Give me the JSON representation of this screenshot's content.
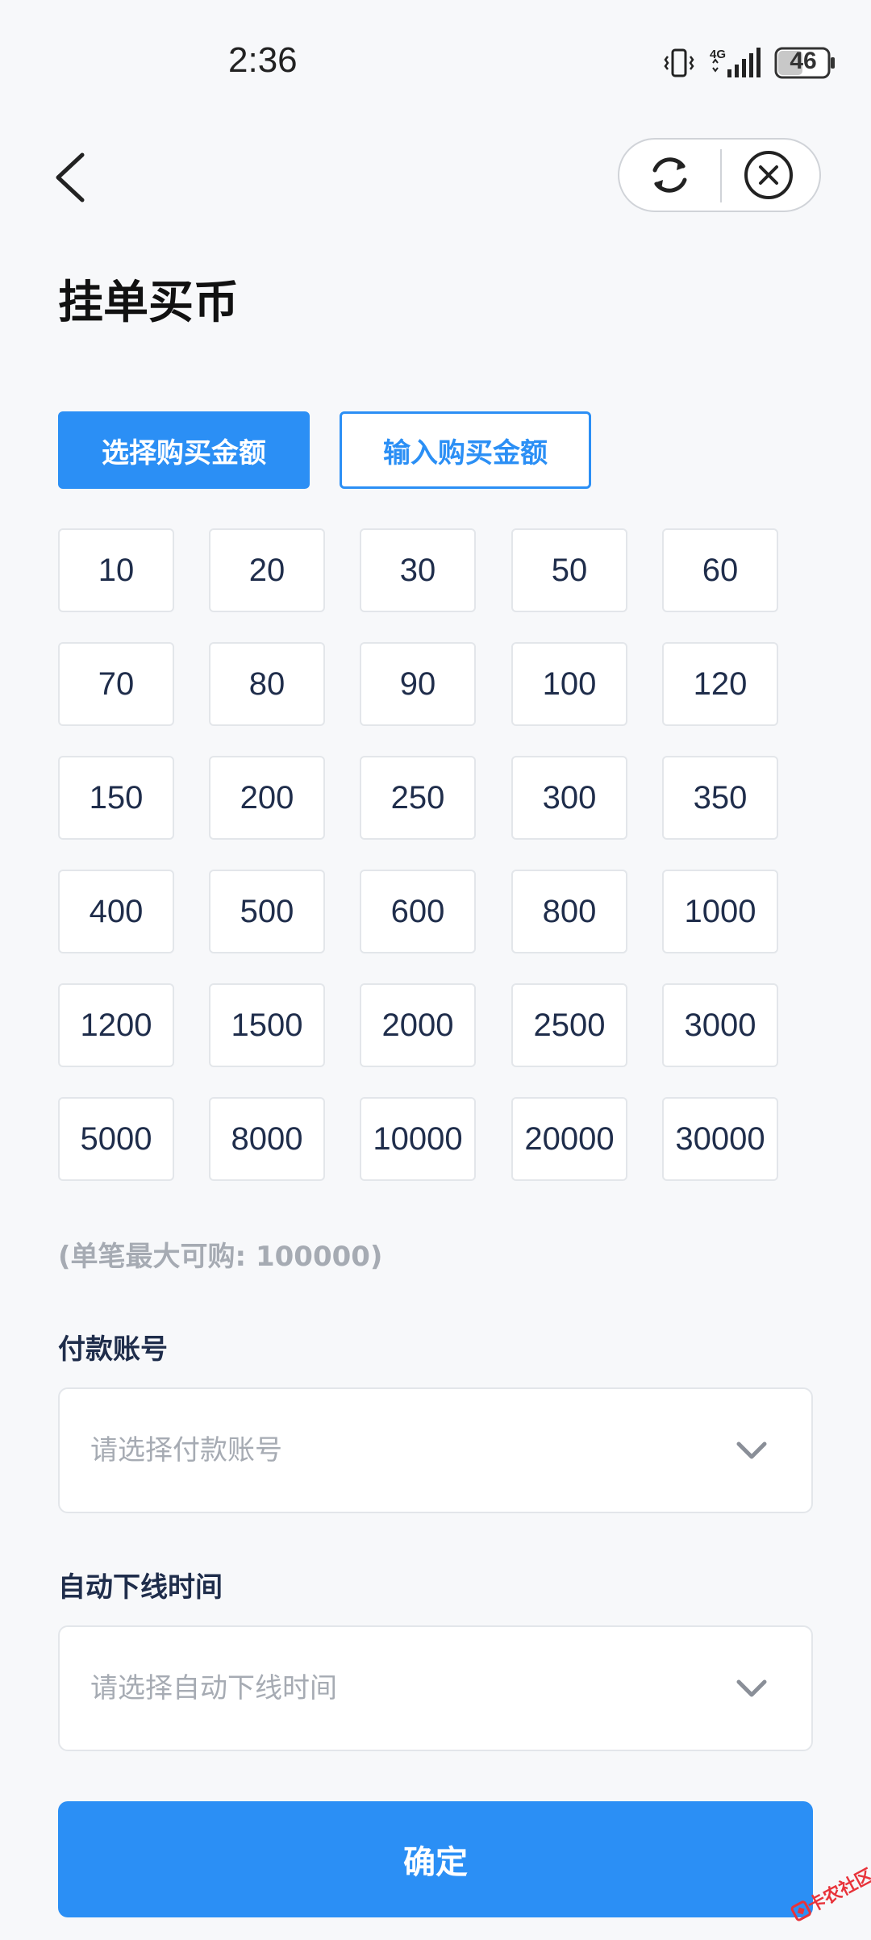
{
  "status_bar": {
    "time": "2:36",
    "network": "4G",
    "battery": "46"
  },
  "nav": {
    "back_icon": "chevron-left-icon",
    "refresh_icon": "refresh-icon",
    "close_icon": "close-circle-icon"
  },
  "page": {
    "title": "挂单买币"
  },
  "mode_tabs": {
    "select_label": "选择购买金额",
    "input_label": "输入购买金额",
    "active": "select"
  },
  "amounts": [
    "10",
    "20",
    "30",
    "50",
    "60",
    "70",
    "80",
    "90",
    "100",
    "120",
    "150",
    "200",
    "250",
    "300",
    "350",
    "400",
    "500",
    "600",
    "800",
    "1000",
    "1200",
    "1500",
    "2000",
    "2500",
    "3000",
    "5000",
    "8000",
    "10000",
    "20000",
    "30000"
  ],
  "max_note": "(单笔最大可购: 100000)",
  "payment_account": {
    "label": "付款账号",
    "placeholder": "请选择付款账号"
  },
  "offline_time": {
    "label": "自动下线时间",
    "placeholder": "请选择自动下线时间"
  },
  "confirm_label": "确定",
  "watermark": {
    "text": "卡农社区"
  },
  "colors": {
    "accent": "#2b8ff5",
    "background": "#f7f8fa",
    "text_primary": "#1f2d4b",
    "text_muted": "#a6abb3"
  }
}
